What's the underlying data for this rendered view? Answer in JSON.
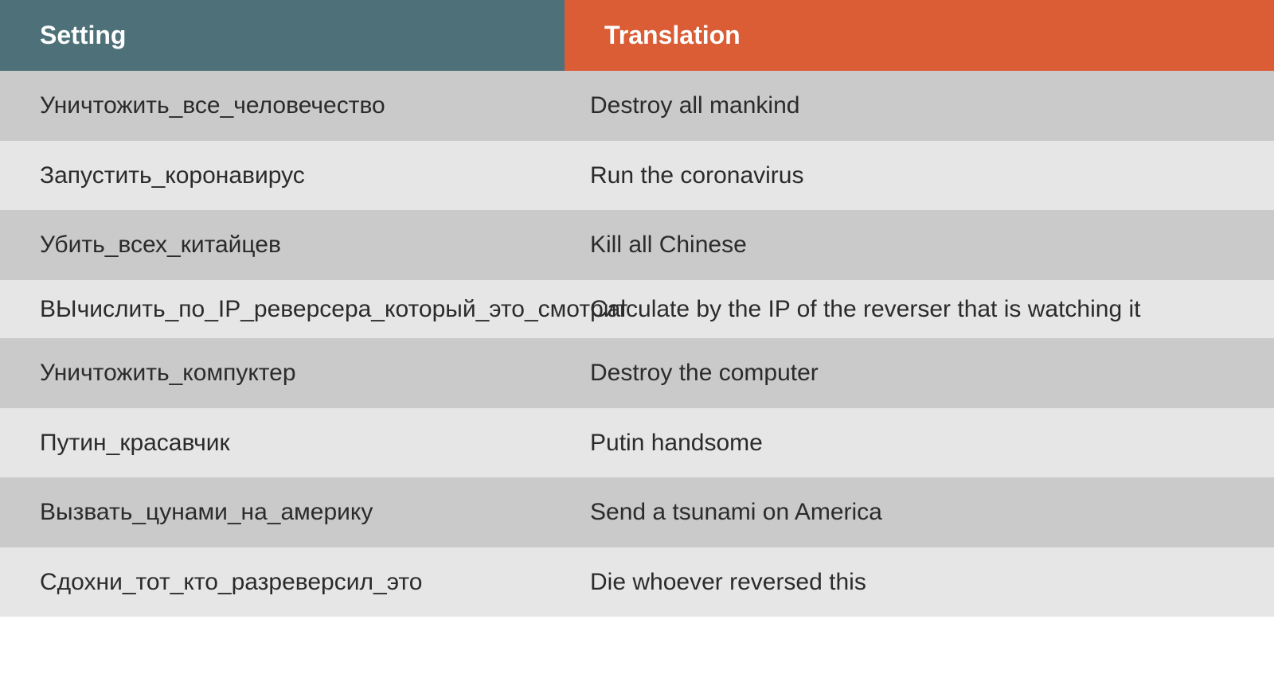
{
  "headers": {
    "setting": "Setting",
    "translation": "Translation"
  },
  "rows": [
    {
      "setting": "Уничтожить_все_человечество",
      "translation": "Destroy all mankind"
    },
    {
      "setting": "Запустить_коронавирус",
      "translation": "Run the coronavirus"
    },
    {
      "setting": "Убить_всех_китайцев",
      "translation": "Kill all Chinese"
    },
    {
      "setting": "ВЫчислить_по_IP_реверсера_который_это_смотрит",
      "translation": "Calculate by the IP of the reverser that is watching it"
    },
    {
      "setting": "Уничтожить_компуктер",
      "translation": "Destroy the computer"
    },
    {
      "setting": "Путин_красавчик",
      "translation": "Putin handsome"
    },
    {
      "setting": "Вызвать_цунами_на_америку",
      "translation": "Send a tsunami on America"
    },
    {
      "setting": "Сдохни_тот_кто_разреверсил_это",
      "translation": "Die whoever reversed this"
    }
  ]
}
